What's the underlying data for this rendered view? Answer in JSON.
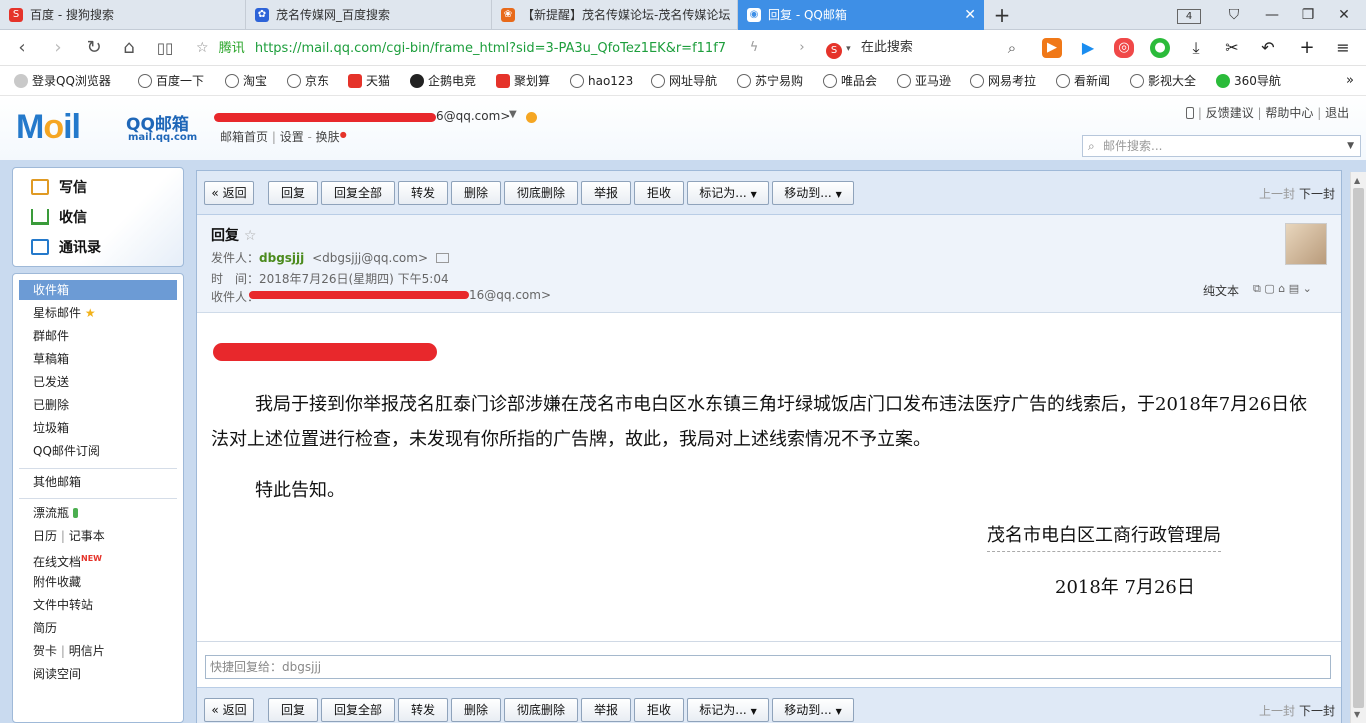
{
  "browser": {
    "tabs": [
      {
        "title": "百度 - 搜狗搜索"
      },
      {
        "title": "茂名传媒网_百度搜索"
      },
      {
        "title": "【新提醒】茂名传媒论坛-茂名传媒论坛"
      },
      {
        "title": "回复 - QQ邮箱"
      }
    ],
    "tab_count": "4",
    "url_prefix": "腾讯",
    "url": "https://mail.qq.com/cgi-bin/frame_html?sid=3-PA3u_QfoTez1EK&r=f11f7",
    "search_placeholder": "在此搜索",
    "bookmarks": [
      "登录QQ浏览器",
      "百度一下",
      "淘宝",
      "京东",
      "天猫",
      "企鹅电竞",
      "聚划算",
      "hao123",
      "网址导航",
      "苏宁易购",
      "唯品会",
      "亚马逊",
      "网易考拉",
      "看新闻",
      "影视大全",
      "360导航"
    ]
  },
  "mail": {
    "logo_text": "QQ邮箱",
    "logo_sub": "mail.qq.com",
    "account_suffix": "6@qq.com>",
    "header_links": [
      "邮箱首页",
      "设置",
      "换肤"
    ],
    "top_right_links": [
      "反馈建议",
      "帮助中心",
      "退出"
    ],
    "search_placeholder": "邮件搜索...",
    "sidebar": {
      "big": [
        "写信",
        "收信",
        "通讯录"
      ],
      "folders": [
        "收件箱",
        "星标邮件",
        "群邮件",
        "草稿箱",
        "已发送",
        "已删除",
        "垃圾箱",
        "QQ邮件订阅"
      ],
      "other": "其他邮箱",
      "extras": [
        "漂流瓶",
        "日历",
        "记事本",
        "在线文档",
        "附件收藏",
        "文件中转站",
        "简历",
        "贺卡",
        "明信片",
        "阅读空间"
      ],
      "new_badge": "NEW"
    },
    "toolbar": {
      "back": "« 返回",
      "buttons": [
        "回复",
        "回复全部",
        "转发",
        "删除",
        "彻底删除",
        "举报",
        "拒收"
      ],
      "mark": "标记为...",
      "move": "移动到...",
      "prev": "上一封",
      "next": "下一封"
    },
    "email": {
      "subject": "回复",
      "from_label": "发件人：",
      "from_name": "dbgsjjj",
      "from_addr": "<dbgsjjj@qq.com>",
      "time_label": "时　间：",
      "time": "2018年7月26日(星期四) 下午5:04",
      "to_label": "收件人：",
      "to_suffix": "16@qq.com>",
      "plain_text": "纯文本",
      "paragraph1": "我局于接到你举报茂名肛泰门诊部涉嫌在茂名市电白区水东镇三角圩绿城饭店门口发布违法医疗广告的线索后，于2018年7月26日依法对上述位置进行检查，未发现有你所指的广告牌，故此，我局对上述线索情况不予立案。",
      "paragraph2": "特此告知。",
      "signature": "茂名市电白区工商行政管理局",
      "date": "2018年  7月26日"
    },
    "quick_reply": "快捷回复给：dbgsjjj"
  }
}
